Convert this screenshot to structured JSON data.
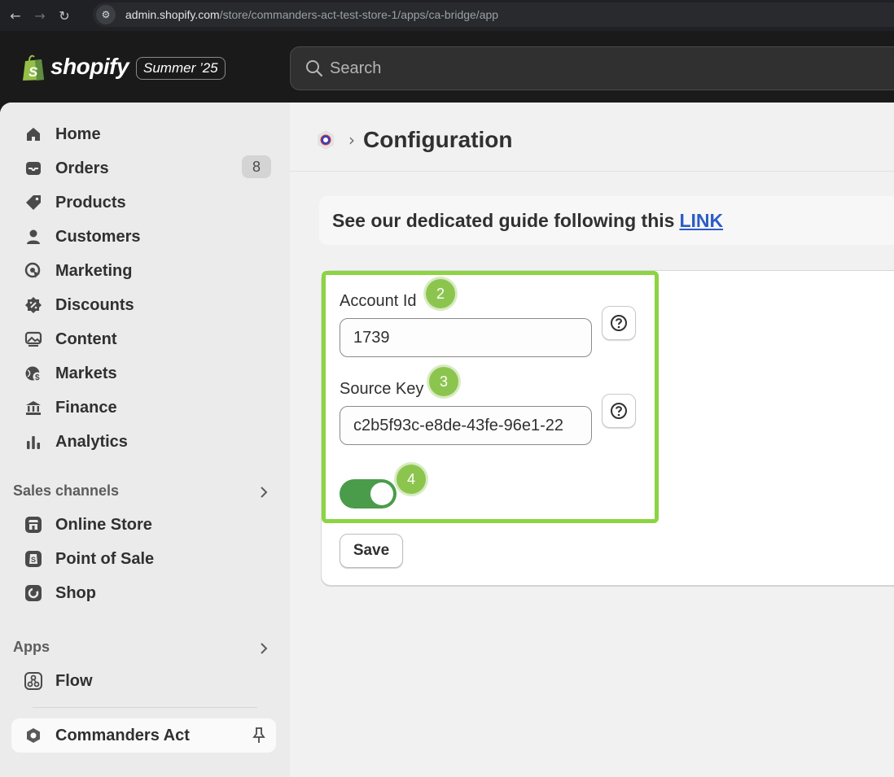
{
  "browser": {
    "url_host": "admin.shopify.com",
    "url_path": "/store/commanders-act-test-store-1/apps/ca-bridge/app"
  },
  "topbar": {
    "logo_text": "shopify",
    "edition_label": "Summer ’25",
    "search_placeholder": "Search"
  },
  "sidebar": {
    "items": [
      {
        "label": "Home",
        "icon": "home-icon"
      },
      {
        "label": "Orders",
        "icon": "orders-icon",
        "badge": "8"
      },
      {
        "label": "Products",
        "icon": "tag-icon"
      },
      {
        "label": "Customers",
        "icon": "person-icon"
      },
      {
        "label": "Marketing",
        "icon": "target-icon"
      },
      {
        "label": "Discounts",
        "icon": "discount-icon"
      },
      {
        "label": "Content",
        "icon": "image-icon"
      },
      {
        "label": "Markets",
        "icon": "globe-icon"
      },
      {
        "label": "Finance",
        "icon": "bank-icon"
      },
      {
        "label": "Analytics",
        "icon": "bar-chart-icon"
      }
    ],
    "sales_channels_header": "Sales channels",
    "sales_channels": [
      {
        "label": "Online Store",
        "icon": "store-icon"
      },
      {
        "label": "Point of Sale",
        "icon": "pos-icon"
      },
      {
        "label": "Shop",
        "icon": "shop-icon"
      }
    ],
    "apps_header": "Apps",
    "apps": [
      {
        "label": "Flow",
        "icon": "flow-icon"
      }
    ],
    "pinned_app": {
      "label": "Commanders Act",
      "icon": "commanders-act-icon"
    }
  },
  "main": {
    "page_title": "Configuration",
    "guide_text": "See our dedicated guide following this",
    "guide_link": "LINK",
    "account_id_label": "Account Id",
    "account_id_value": "1739",
    "source_key_label": "Source Key",
    "source_key_value": "c2b5f93c-e8de-43fe-96e1-22",
    "save_label": "Save",
    "toggle_on": true,
    "step_badges": [
      "2",
      "3",
      "4"
    ]
  },
  "colors": {
    "highlight": "#8cd442",
    "step_badge": "#8cc54e",
    "toggle_on": "#4a9c4a",
    "link": "#2c5cc5"
  }
}
